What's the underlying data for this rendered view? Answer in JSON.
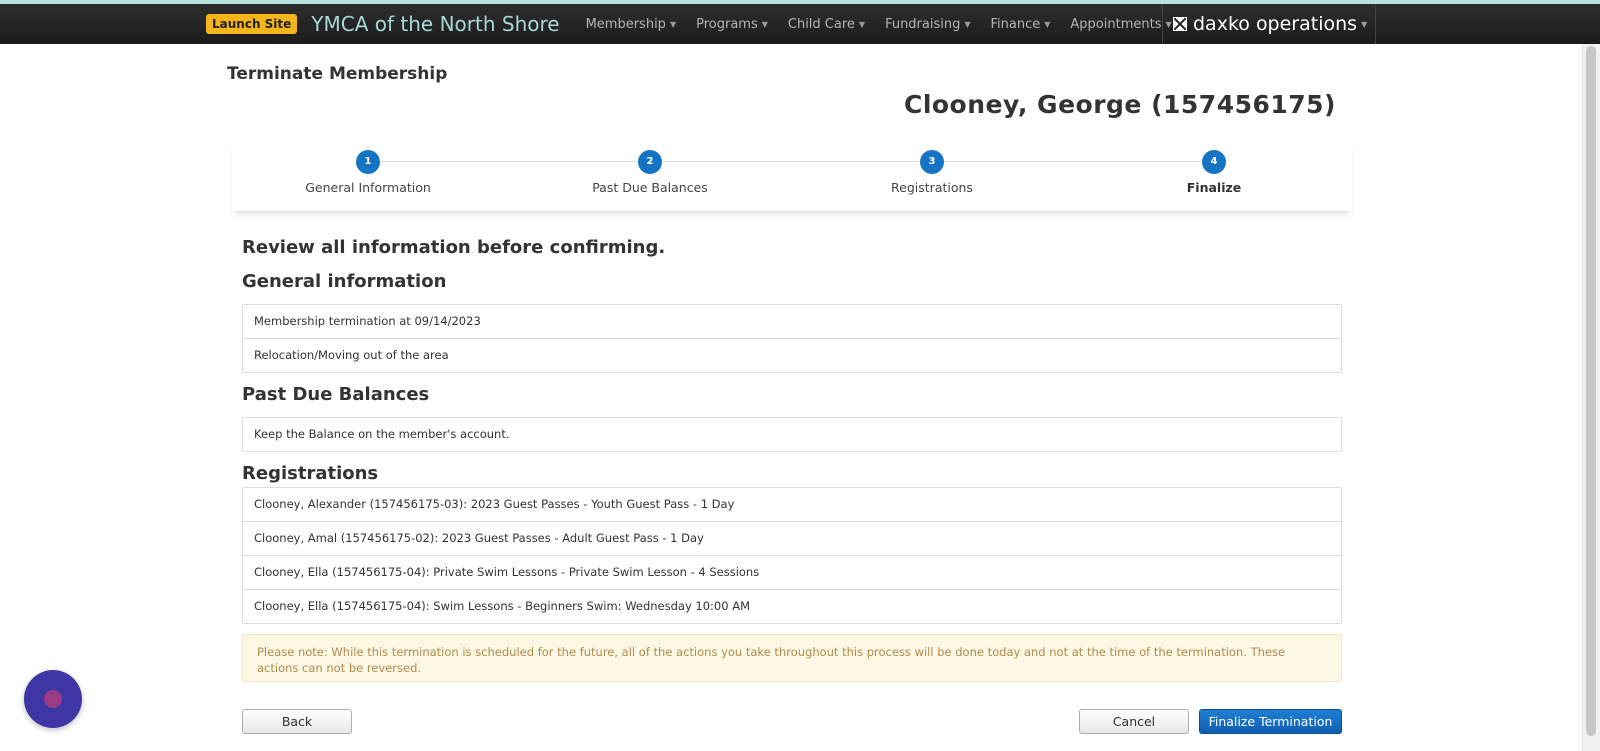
{
  "nav": {
    "launch_label": "Launch Site",
    "brand": "YMCA of the North Shore",
    "menu": [
      "Membership",
      "Programs",
      "Child Care",
      "Fundraising",
      "Finance",
      "Appointments"
    ],
    "product": "daxko operations"
  },
  "page": {
    "title": "Terminate Membership",
    "member": "Clooney, George (157456175)"
  },
  "steps": [
    {
      "number": "1",
      "label": "General Information"
    },
    {
      "number": "2",
      "label": "Past Due Balances"
    },
    {
      "number": "3",
      "label": "Registrations"
    },
    {
      "number": "4",
      "label": "Finalize"
    }
  ],
  "review": {
    "heading": "Review all information before confirming.",
    "general": {
      "heading": "General information",
      "rows": [
        "Membership termination at 09/14/2023",
        "Relocation/Moving out of the area"
      ]
    },
    "past_due": {
      "heading": "Past Due Balances",
      "rows": [
        "Keep the Balance on the member's account."
      ]
    },
    "registrations": {
      "heading": "Registrations",
      "rows": [
        "Clooney, Alexander (157456175-03): 2023 Guest Passes - Youth Guest Pass - 1 Day",
        "Clooney, Amal (157456175-02): 2023 Guest Passes - Adult Guest Pass - 1 Day",
        "Clooney, Ella (157456175-04): Private Swim Lessons - Private Swim Lesson - 4 Sessions",
        "Clooney, Ella (157456175-04): Swim Lessons - Beginners Swim: Wednesday 10:00 AM"
      ]
    }
  },
  "note": "Please note: While this termination is scheduled for the future, all of the actions you take throughout this process will be done today and not at the time of the termination. These actions can not be reversed.",
  "buttons": {
    "back": "Back",
    "cancel": "Cancel",
    "finalize": "Finalize Termination"
  },
  "colors": {
    "accent": "#1574c4",
    "launch": "#f6b51b",
    "brand": "#a9d8d4"
  }
}
